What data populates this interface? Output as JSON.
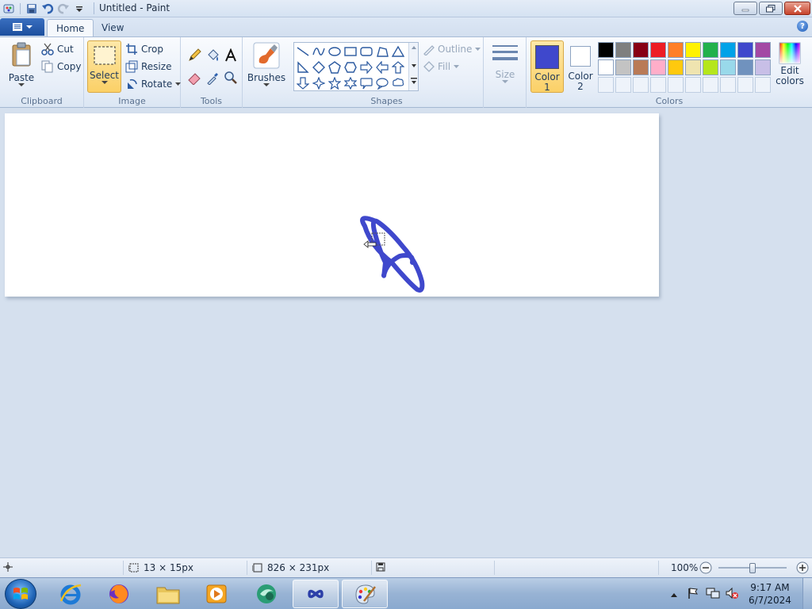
{
  "window": {
    "title": "Untitled - Paint"
  },
  "tabs": [
    {
      "label": "Home"
    },
    {
      "label": "View"
    }
  ],
  "clipboard": {
    "paste": "Paste",
    "cut": "Cut",
    "copy": "Copy",
    "group": "Clipboard"
  },
  "image": {
    "select": "Select",
    "crop": "Crop",
    "resize": "Resize",
    "rotate": "Rotate",
    "group": "Image"
  },
  "tools": {
    "group": "Tools"
  },
  "brushes": {
    "label": "Brushes"
  },
  "shapes": {
    "outline": "Outline",
    "fill": "Fill",
    "group": "Shapes"
  },
  "size": {
    "label": "Size"
  },
  "colors": {
    "color1_label": "Color",
    "color1_num": "1",
    "color2_label": "Color",
    "color2_num": "2",
    "edit_label": "Edit",
    "edit_label2": "colors",
    "group": "Colors",
    "color1": "#3f48cc",
    "color2": "#ffffff",
    "palette_row1": [
      "#000000",
      "#7f7f7f",
      "#880015",
      "#ed1c24",
      "#ff7f27",
      "#fff200",
      "#22b14c",
      "#00a2e8",
      "#3f48cc",
      "#a349a4"
    ],
    "palette_row2": [
      "#ffffff",
      "#c3c3c3",
      "#b97a57",
      "#ffaec9",
      "#ffc90e",
      "#efe4b0",
      "#b5e61d",
      "#99d9ea",
      "#7092be",
      "#c8bfe7"
    ]
  },
  "status": {
    "selection_size": "13 × 15px",
    "canvas_size": "826 × 231px",
    "zoom": "100%",
    "zoom_level": 0.5
  },
  "clock": {
    "time": "9:17 AM",
    "date": "6/7/2024"
  }
}
